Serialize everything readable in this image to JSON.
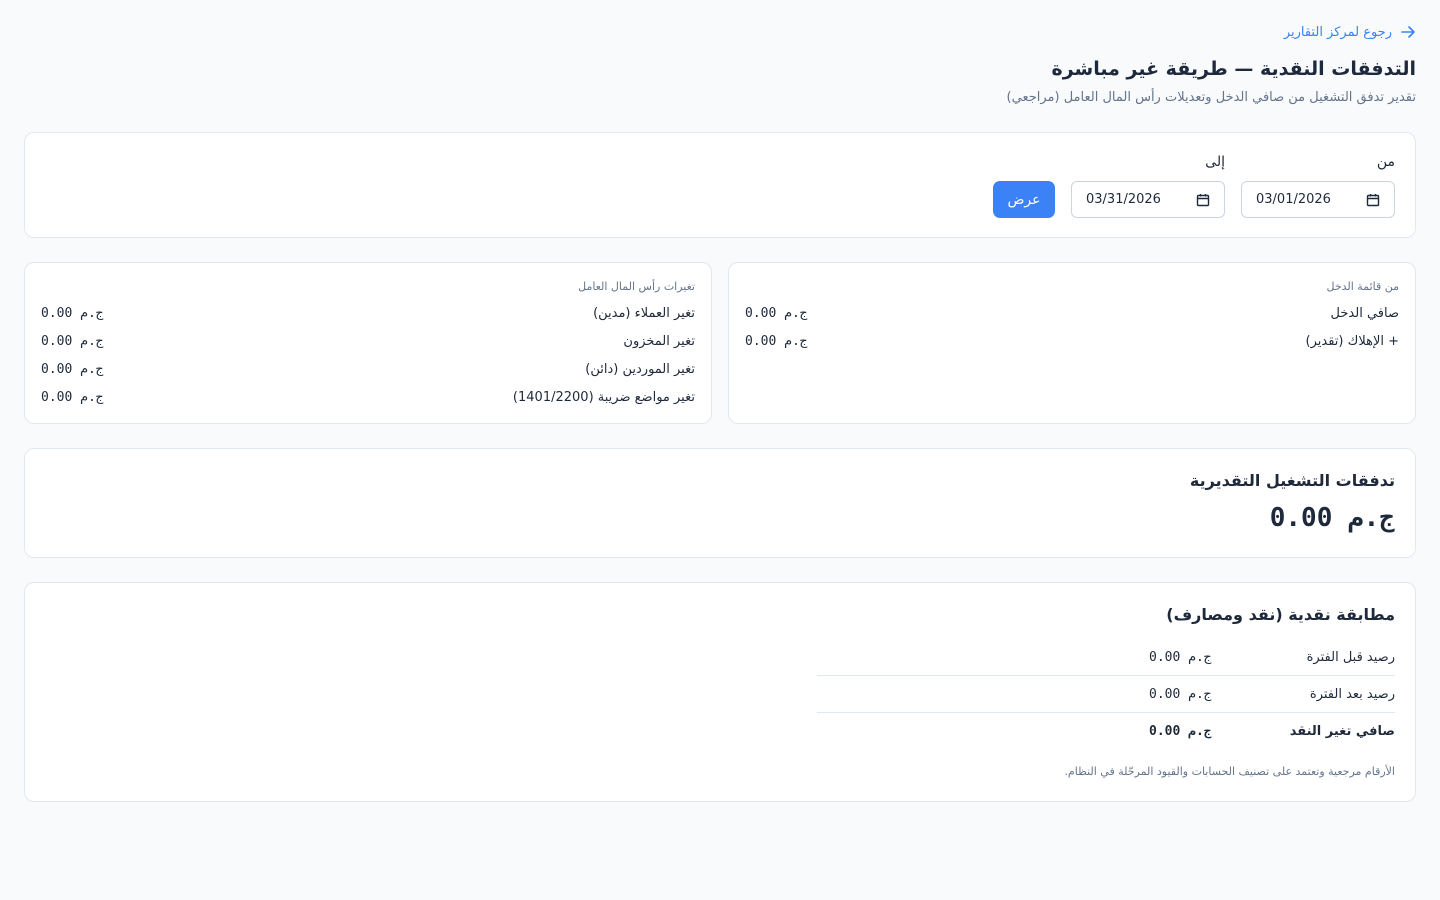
{
  "back_link": {
    "label": "رجوع لمركز التقارير",
    "icon": "arrow-right-icon"
  },
  "header": {
    "title": "التدفقات النقدية — طريقة غير مباشرة",
    "subtitle": "تقدير تدفق التشغيل من صافي الدخل وتعديلات رأس المال العامل (مراجعي)"
  },
  "filters": {
    "from_label": "من",
    "from_value": "03/01/2026",
    "to_label": "إلى",
    "to_value": "03/31/2026",
    "show_button": "عرض"
  },
  "income": {
    "caption": "من قائمة الدخل",
    "rows": [
      {
        "label": "صافي الدخل",
        "amount": "0.00 ج.م"
      },
      {
        "label": "+ الإهلاك (تقدير)",
        "amount": "0.00 ج.م"
      }
    ]
  },
  "working_capital": {
    "caption": "تغيرات رأس المال العامل",
    "rows": [
      {
        "label": "تغير العملاء (مدين)",
        "amount": "0.00 ج.م"
      },
      {
        "label": "تغير المخزون",
        "amount": "0.00 ج.م"
      },
      {
        "label": "تغير الموردين (دائن)",
        "amount": "0.00 ج.م"
      },
      {
        "label": "تغير مواضع ضريبة (1401/2200)",
        "amount": "0.00 ج.م"
      }
    ]
  },
  "operating": {
    "title": "تدفقات التشغيل التقديرية",
    "amount": "0.00 ج.م"
  },
  "reconciliation": {
    "title": "مطابقة نقدية (نقد ومصارف)",
    "rows": [
      {
        "label": "رصيد قبل الفترة",
        "amount": "0.00 ج.م"
      },
      {
        "label": "رصيد بعد الفترة",
        "amount": "0.00 ج.م"
      },
      {
        "label": "صافي تغير النقد",
        "amount": "0.00 ج.م"
      }
    ],
    "note": "الأرقام مرجعية وتعتمد على تصنيف الحسابات والقيود المرحّلة في النظام."
  },
  "colors": {
    "accent": "#3b82f6",
    "background": "#f8fafc",
    "text": "#1e293b",
    "muted": "#64748b",
    "border": "#e2e8f0"
  }
}
